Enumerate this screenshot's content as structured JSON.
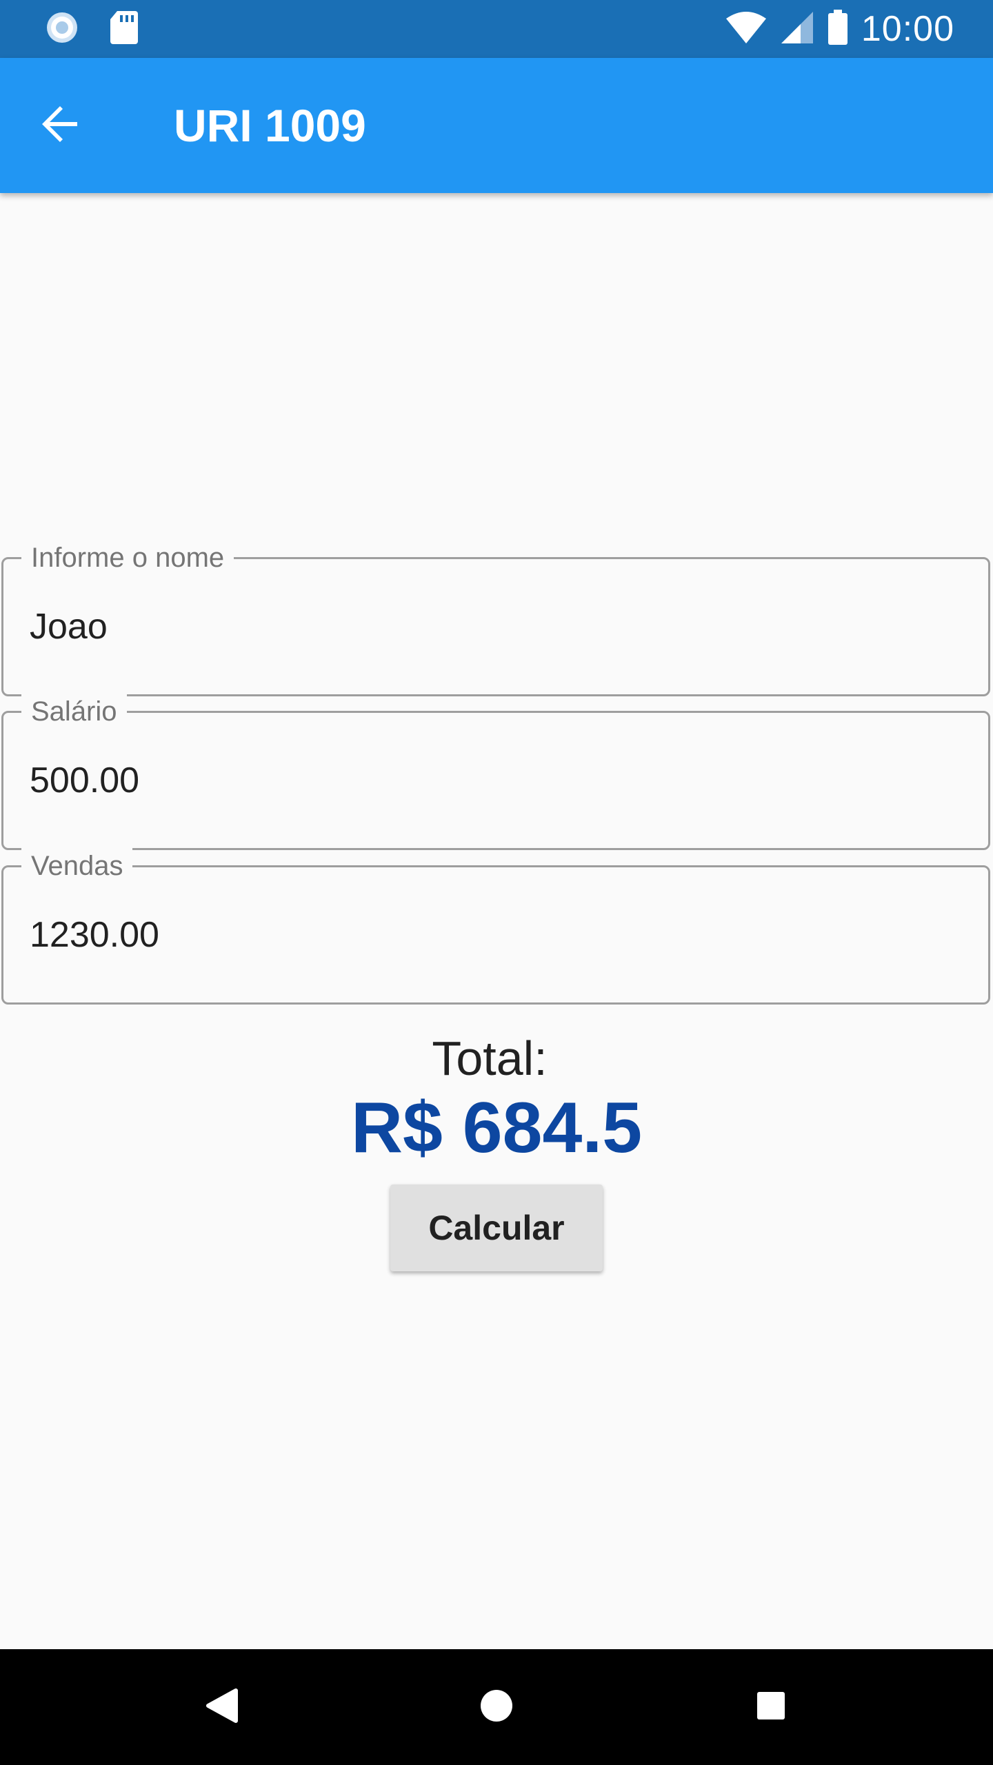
{
  "status_bar": {
    "time": "10:00",
    "icons": [
      "sync-icon",
      "sd-card-icon",
      "wifi-icon",
      "cell-signal-icon",
      "battery-icon"
    ],
    "background_color": "#1a6fb5"
  },
  "app_bar": {
    "title": "URI 1009",
    "back_icon": "arrow-back-icon",
    "background_color": "#2196f3"
  },
  "form": {
    "name_field": {
      "label": "Informe o nome",
      "value": "Joao"
    },
    "salary_field": {
      "label": "Salário",
      "value": "500.00"
    },
    "sales_field": {
      "label": "Vendas",
      "value": "1230.00"
    }
  },
  "result": {
    "label": "Total:",
    "value": "R$ 684.5",
    "value_color": "#0d47a1"
  },
  "calculate_button": {
    "label": "Calcular"
  },
  "nav_bar": {
    "icons": [
      "back-triangle-icon",
      "home-circle-icon",
      "recents-square-icon"
    ]
  }
}
